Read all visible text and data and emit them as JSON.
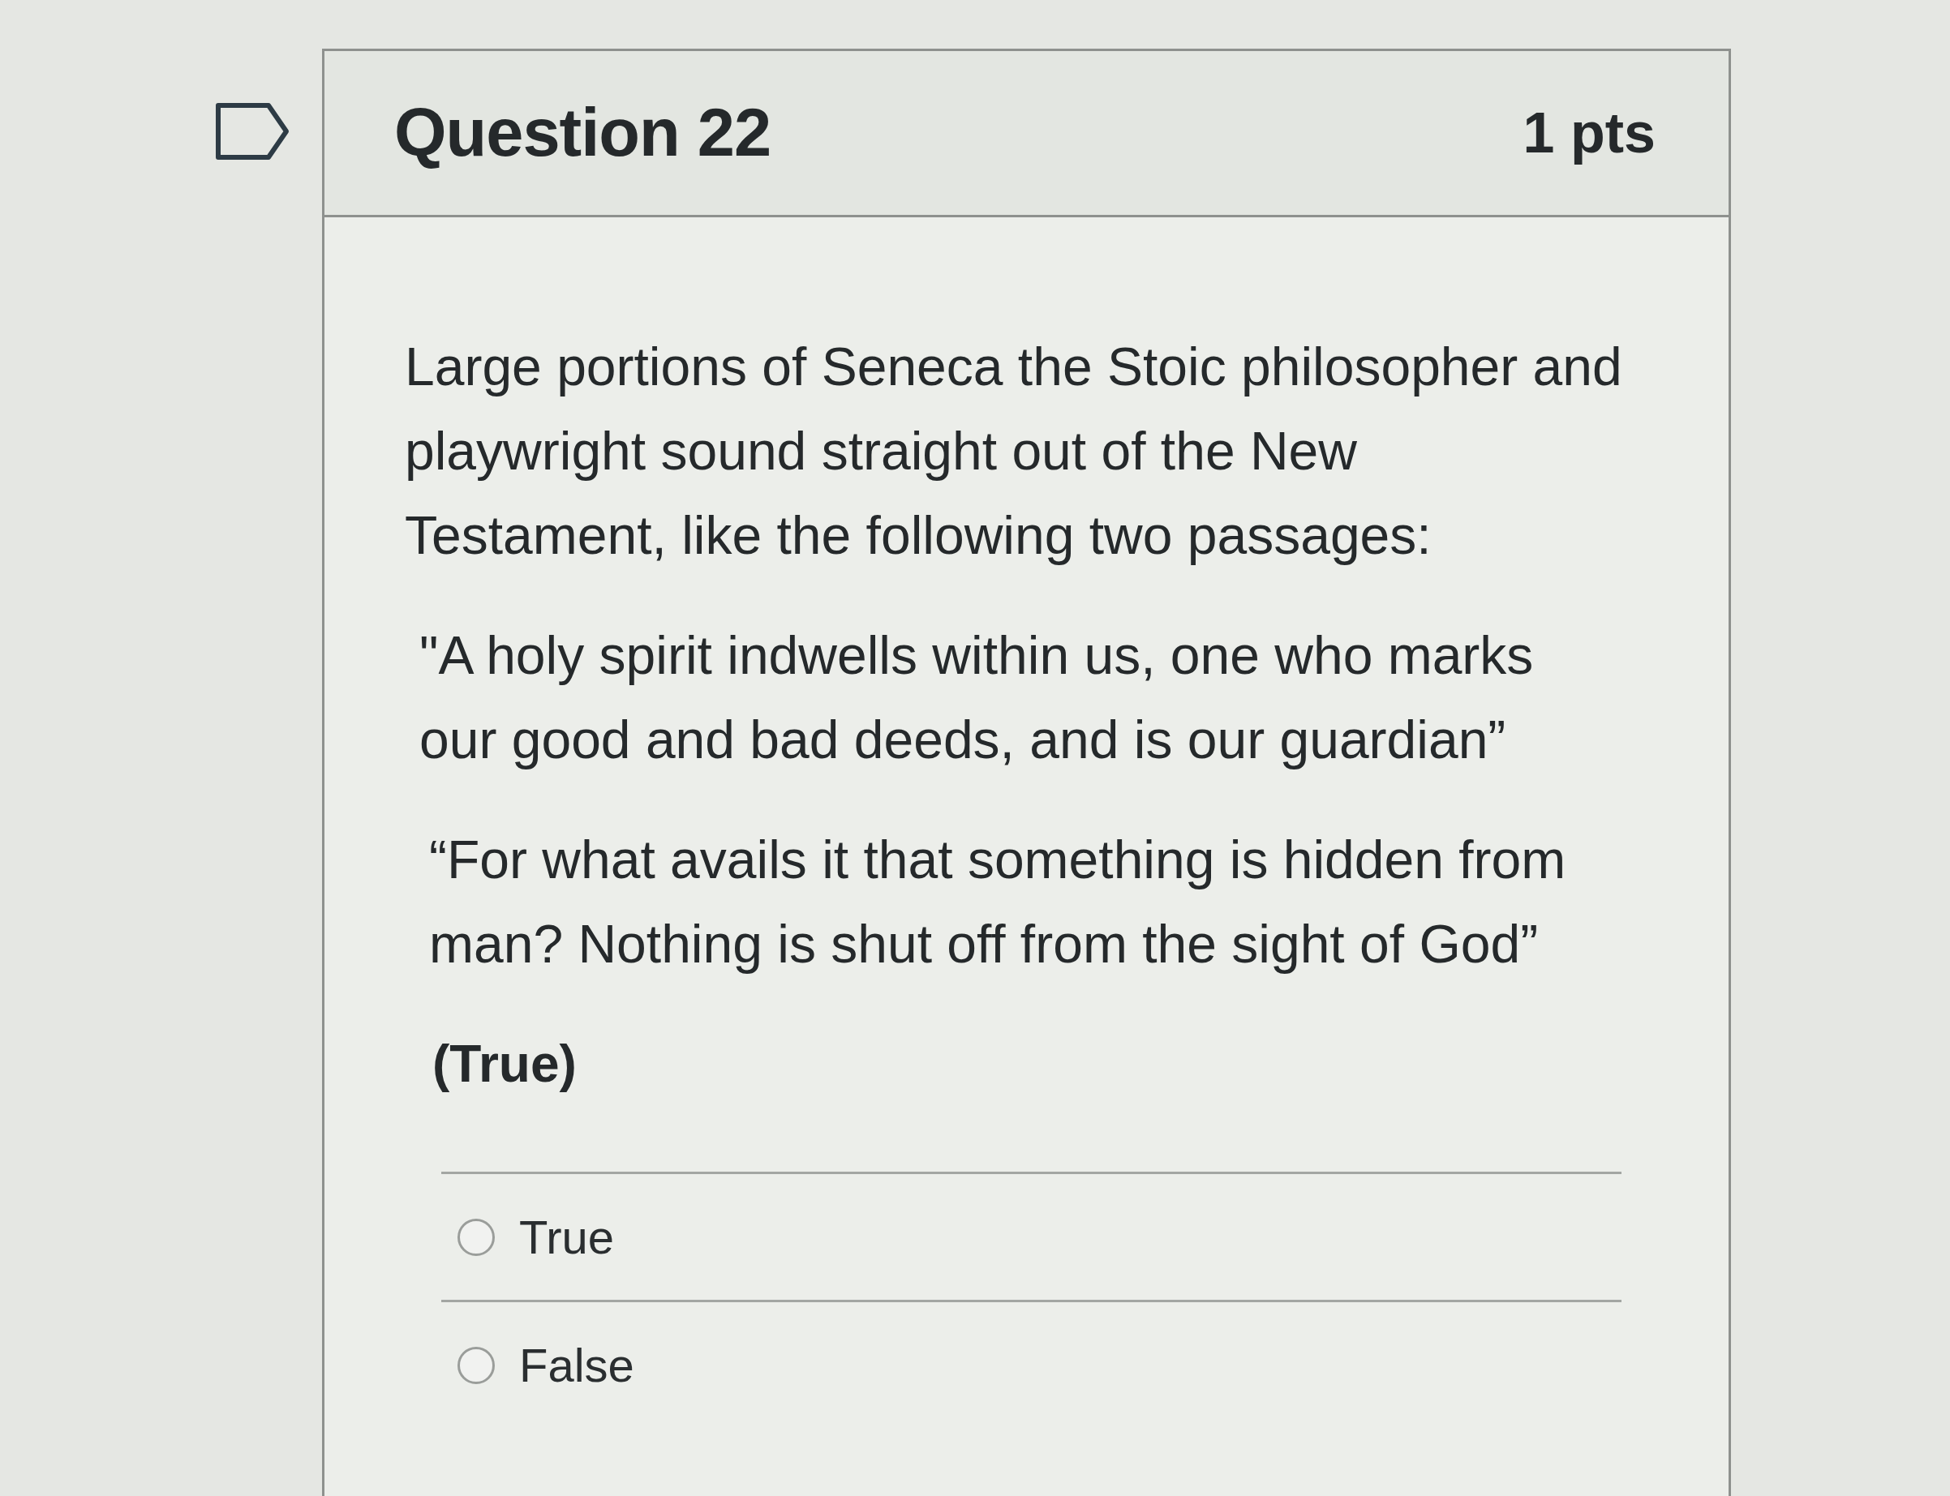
{
  "flag": {
    "flagged": false
  },
  "question": {
    "title": "Question 22",
    "points": "1 pts"
  },
  "body": {
    "paragraphs": [
      "Large portions of Seneca the Stoic philosopher and playwright sound straight out of the New Testament, like the following two passages:",
      "\"A holy spirit indwells within us, one who marks our good and bad deeds, and is our guardian”",
      "“For what avails it that something is hidden from man? Nothing is shut off from the sight of God”"
    ],
    "note": "(True)"
  },
  "answers": [
    {
      "label": "True",
      "selected": false
    },
    {
      "label": "False",
      "selected": false
    }
  ]
}
